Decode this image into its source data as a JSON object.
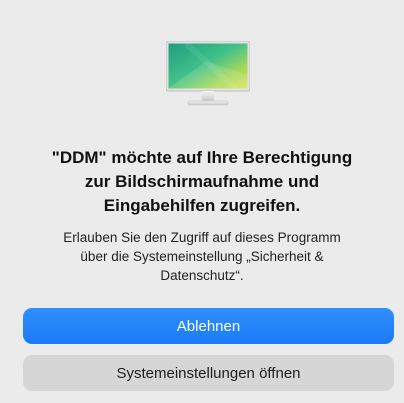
{
  "dialog": {
    "icon": "monitor-icon",
    "title": "\"DDM\" möchte auf Ihre Berechtigung\nzur Bildschirmaufnahme und\nEingabehilfen zugreifen.",
    "message": "Erlauben Sie den Zugriff auf dieses Programm\nüber die Systemeinstellung „Sicherheit &\nDatenschutz“.",
    "primary_button": "Ablehnen",
    "secondary_button": "Systemeinstellungen öffnen"
  },
  "colors": {
    "accent": "#1a7bf5",
    "dialog_bg": "#ebebeb",
    "secondary_button_bg": "#d6d6d6"
  }
}
